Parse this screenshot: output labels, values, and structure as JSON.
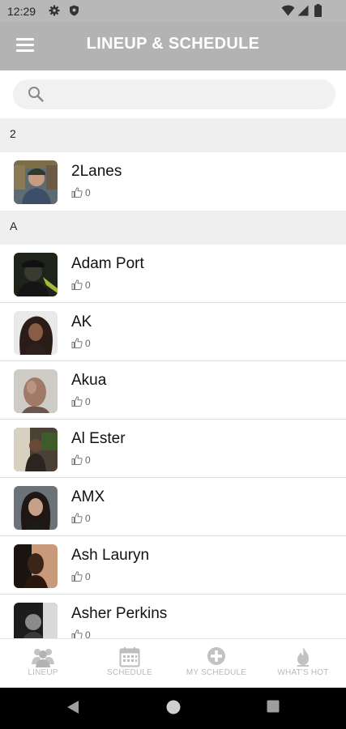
{
  "status_bar": {
    "time": "12:29",
    "icons": [
      "settings-icon",
      "shield-icon",
      "wifi-icon",
      "signal-icon",
      "battery-icon"
    ]
  },
  "header": {
    "title": "LINEUP & SCHEDULE",
    "menu_icon": "hamburger-menu-icon"
  },
  "search": {
    "placeholder": "",
    "icon": "search-icon"
  },
  "sections": [
    {
      "header": "2",
      "artists": [
        {
          "name": "2Lanes",
          "likes": "0"
        }
      ]
    },
    {
      "header": "A",
      "artists": [
        {
          "name": "Adam Port",
          "likes": "0"
        },
        {
          "name": "AK",
          "likes": "0"
        },
        {
          "name": "Akua",
          "likes": "0"
        },
        {
          "name": "Al Ester",
          "likes": "0"
        },
        {
          "name": "AMX",
          "likes": "0"
        },
        {
          "name": "Ash Lauryn",
          "likes": "0"
        },
        {
          "name": "Asher Perkins",
          "likes": "0"
        }
      ]
    }
  ],
  "bottom_nav": [
    {
      "label": "LINEUP",
      "icon": "people-icon"
    },
    {
      "label": "SCHEDULE",
      "icon": "calendar-icon"
    },
    {
      "label": "MY SCHEDULE",
      "icon": "plus-circle-icon"
    },
    {
      "label": "WHAT'S HOT",
      "icon": "flame-icon"
    }
  ],
  "colors": {
    "header_bg": "#b3b3b3",
    "section_bg": "#efefef",
    "nav_label": "#b9b9b9"
  }
}
